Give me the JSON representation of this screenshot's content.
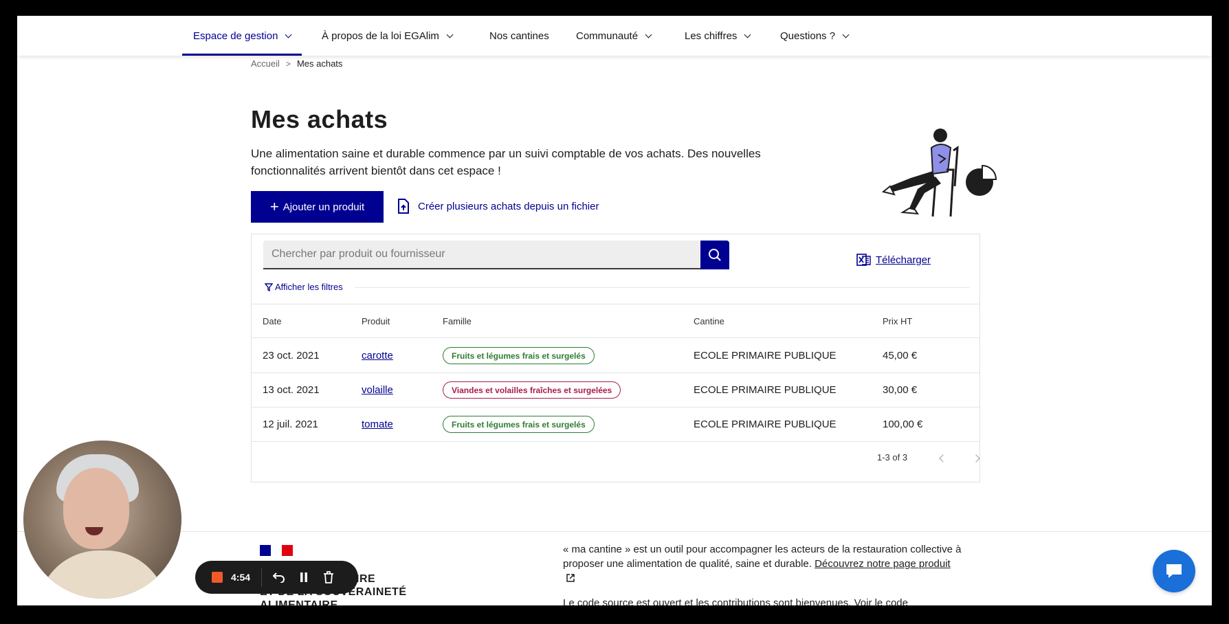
{
  "nav": {
    "items": [
      {
        "label": "Espace de gestion",
        "has_chevron": true,
        "active": true
      },
      {
        "label": "À propos de la loi EGAlim",
        "has_chevron": true
      },
      {
        "label": "Nos cantines",
        "has_chevron": false
      },
      {
        "label": "Communauté",
        "has_chevron": true
      },
      {
        "label": "Les chiffres",
        "has_chevron": true
      },
      {
        "label": "Questions ?",
        "has_chevron": true
      }
    ]
  },
  "breadcrumb": {
    "home": "Accueil",
    "current": "Mes achats"
  },
  "page": {
    "title": "Mes achats",
    "intro": "Une alimentation saine et durable commence par un suivi comptable de vos achats. Des nouvelles fonctionnalités arrivent bientôt dans cet espace !"
  },
  "actions": {
    "add_product": "Ajouter un produit",
    "bulk_import": "Créer plusieurs achats depuis un fichier"
  },
  "search": {
    "placeholder": "Chercher par produit ou fournisseur",
    "value": ""
  },
  "download_label": "Télécharger",
  "filters_label": "Afficher les filtres",
  "table": {
    "headers": [
      "Date",
      "Produit",
      "Famille",
      "Cantine",
      "Prix HT"
    ],
    "rows": [
      {
        "date": "23 oct. 2021",
        "product": "carotte",
        "family": "Fruits et légumes frais et surgelés",
        "family_color": "green",
        "canteen": "ECOLE PRIMAIRE PUBLIQUE",
        "price": "45,00 €"
      },
      {
        "date": "13 oct. 2021",
        "product": "volaille",
        "family": "Viandes et volailles fraîches et surgelées",
        "family_color": "red",
        "canteen": "ECOLE PRIMAIRE PUBLIQUE",
        "price": "30,00 €"
      },
      {
        "date": "12 juil. 2021",
        "product": "tomate",
        "family": "Fruits et légumes frais et surgelés",
        "family_color": "green",
        "canteen": "ECOLE PRIMAIRE PUBLIQUE",
        "price": "100,00 €"
      }
    ],
    "pagination": "1-3 of 3"
  },
  "footer": {
    "ministry_lines": [
      "IRE",
      "ET DE LA SOUVERAINETÉ",
      "ALIMENTAIRE"
    ],
    "text": "« ma cantine » est un outil pour accompagner les acteurs de la restauration collective à proposer une alimentation de qualité, saine et durable.",
    "link": "Découvrez notre page produit",
    "text2": "Le code source est ouvert et les contributions sont bienvenues. Voir le code"
  },
  "recorder": {
    "time": "4:54"
  },
  "colors": {
    "primary": "#000091",
    "green_tag": "#2e7d32",
    "red_tag": "#a81d4d",
    "chat": "#1a6fd8",
    "record": "#f05a28"
  }
}
